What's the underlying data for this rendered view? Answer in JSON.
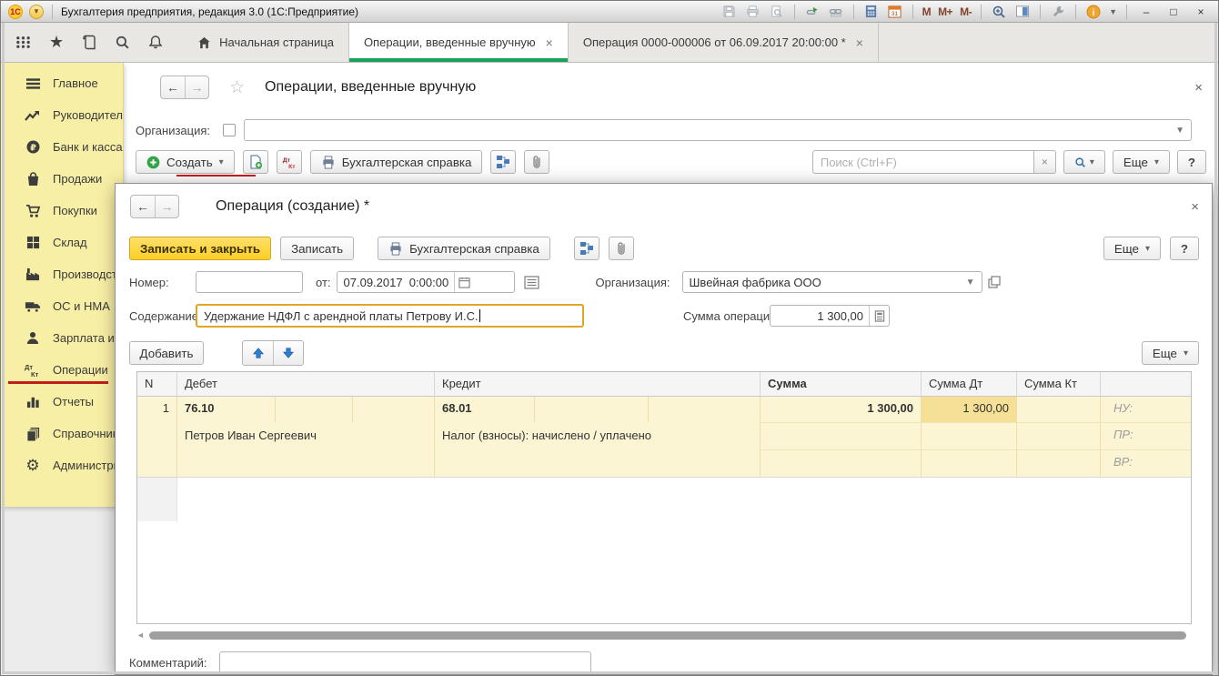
{
  "titlebar": {
    "title": "Бухгалтерия предприятия, редакция 3.0  (1С:Предприятие)",
    "logo": "1С",
    "m": [
      "M",
      "M+",
      "M-"
    ],
    "win": {
      "min": "–",
      "max": "□",
      "close": "×"
    }
  },
  "tabs": [
    {
      "label": "Начальная страница"
    },
    {
      "label": "Операции, введенные вручную"
    },
    {
      "label": "Операция 0000-000006 от 06.09.2017 20:00:00 *"
    }
  ],
  "sidebar": [
    {
      "label": "Главное"
    },
    {
      "label": "Руководителю"
    },
    {
      "label": "Банк и касса"
    },
    {
      "label": "Продажи"
    },
    {
      "label": "Покупки"
    },
    {
      "label": "Склад"
    },
    {
      "label": "Производство"
    },
    {
      "label": "ОС и НМА"
    },
    {
      "label": "Зарплата и кадры"
    },
    {
      "label": "Операции"
    },
    {
      "label": "Отчеты"
    },
    {
      "label": "Справочники"
    },
    {
      "label": "Администрирование"
    }
  ],
  "lf": {
    "title": "Операции, введенные вручную",
    "org_label": "Организация:",
    "create": "Создать",
    "spravka": "Бухгалтерская справка",
    "search_ph": "Поиск (Ctrl+F)",
    "more": "Еще",
    "help": "?"
  },
  "op": {
    "title": "Операция (создание) *",
    "save_close": "Записать и закрыть",
    "save": "Записать",
    "spravka": "Бухгалтерская справка",
    "more": "Еще",
    "help": "?",
    "add": "Добавить",
    "comment_label": "Комментарий:",
    "f": {
      "number_label": "Номер:",
      "number_value": "",
      "date_label": "от:",
      "date_value": "07.09.2017  0:00:00",
      "org_label": "Организация:",
      "org_value": "Швейная фабрика ООО",
      "content_label": "Содержание:",
      "content_value": "Удержание НДФЛ с арендной платы Петрову И.С.",
      "sum_label": "Сумма операции:",
      "sum_value": "1 300,00"
    },
    "t": {
      "h": [
        "N",
        "Дебет",
        "Кредит",
        "Сумма",
        "Сумма Дт",
        "Сумма Кт",
        ""
      ],
      "row": {
        "n": "1",
        "da": "76.10",
        "dan": "Петров Иван Сергеевич",
        "ca": "68.01",
        "can": "Налог (взносы): начислено / уплачено",
        "sum": "1 300,00",
        "sdt": "1 300,00",
        "skt": "",
        "nu": "НУ:",
        "pr": "ПР:",
        "vr": "ВР:"
      }
    }
  },
  "glyphs": {
    "back": "←",
    "forward": "→",
    "dropdown": "▾",
    "star": "☆",
    "close": "×",
    "left_scroll": "◄"
  },
  "colors": {
    "sidebar_yellow": "#f8efa6",
    "active_tab_green": "#1ba158",
    "primary_yellow": "#fbd53c",
    "row_yellow": "#fcf5d4",
    "selected_cell": "#f5e096",
    "marker_red": "#c61c1c",
    "focus_border": "#e2a523"
  }
}
